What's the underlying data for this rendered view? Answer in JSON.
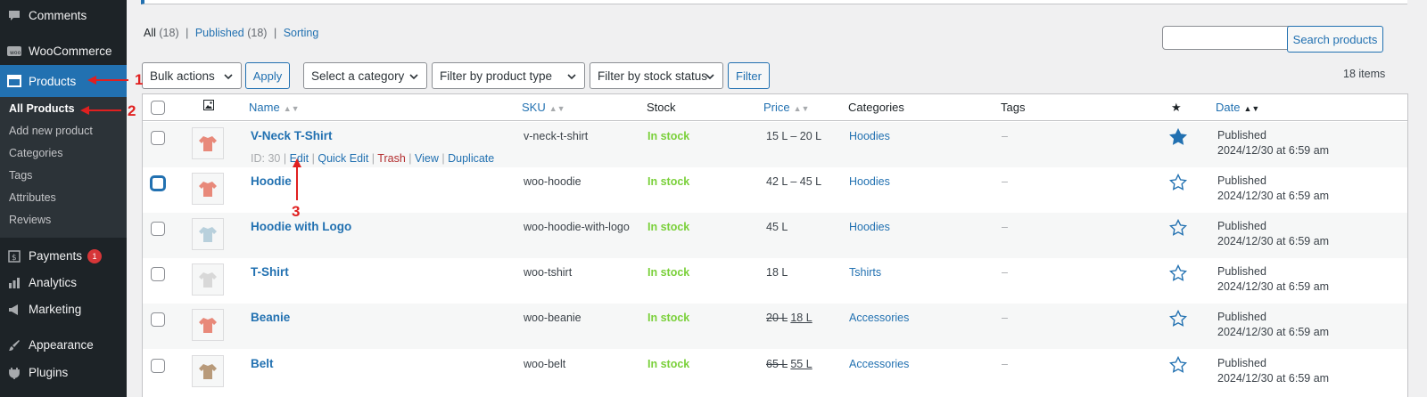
{
  "sidebar": {
    "items": [
      {
        "label": "Comments",
        "icon": "comments-icon"
      },
      {
        "label": "WooCommerce",
        "icon": "woocommerce-icon"
      },
      {
        "label": "Products",
        "icon": "products-icon"
      },
      {
        "label": "Payments",
        "icon": "payments-icon",
        "badge": "1"
      },
      {
        "label": "Analytics",
        "icon": "analytics-icon"
      },
      {
        "label": "Marketing",
        "icon": "marketing-icon"
      },
      {
        "label": "Appearance",
        "icon": "appearance-icon"
      },
      {
        "label": "Plugins",
        "icon": "plugins-icon"
      }
    ],
    "submenu": [
      "All Products",
      "Add new product",
      "Categories",
      "Tags",
      "Attributes",
      "Reviews"
    ]
  },
  "views": {
    "all": "All",
    "all_count": "(18)",
    "sep": "|",
    "published": "Published",
    "published_count": "(18)",
    "sorting": "Sorting"
  },
  "search": {
    "value": "",
    "button": "Search products"
  },
  "toolbar": {
    "bulk_actions": "Bulk actions",
    "apply": "Apply",
    "category": "Select a category",
    "product_type": "Filter by product type",
    "stock_status": "Filter by stock status",
    "filter": "Filter",
    "items_count": "18 items"
  },
  "table": {
    "headers": {
      "name": "Name",
      "sku": "SKU",
      "stock": "Stock",
      "price": "Price",
      "categories": "Categories",
      "tags": "Tags",
      "date": "Date"
    },
    "rows": [
      {
        "name": "V-Neck T-Shirt",
        "sku": "v-neck-t-shirt",
        "stock": "In stock",
        "price": "15 L – 20 L",
        "category": "Hoodies",
        "tags": "–",
        "status": "Published",
        "date": "2024/12/30 at 6:59 am",
        "featured": true
      },
      {
        "name": "Hoodie",
        "sku": "woo-hoodie",
        "stock": "In stock",
        "price": "42 L – 45 L",
        "category": "Hoodies",
        "tags": "–",
        "status": "Published",
        "date": "2024/12/30 at 6:59 am",
        "featured": false
      },
      {
        "name": "Hoodie with Logo",
        "sku": "woo-hoodie-with-logo",
        "stock": "In stock",
        "price": "45 L",
        "category": "Hoodies",
        "tags": "–",
        "status": "Published",
        "date": "2024/12/30 at 6:59 am",
        "featured": false
      },
      {
        "name": "T-Shirt",
        "sku": "woo-tshirt",
        "stock": "In stock",
        "price": "18 L",
        "category": "Tshirts",
        "tags": "–",
        "status": "Published",
        "date": "2024/12/30 at 6:59 am",
        "featured": false
      },
      {
        "name": "Beanie",
        "sku": "woo-beanie",
        "stock": "In stock",
        "price_old": "20 L",
        "price_new": "18 L",
        "category": "Accessories",
        "tags": "–",
        "status": "Published",
        "date": "2024/12/30 at 6:59 am",
        "featured": false
      },
      {
        "name": "Belt",
        "sku": "woo-belt",
        "stock": "In stock",
        "price_old": "65 L",
        "price_new": "55 L",
        "category": "Accessories",
        "tags": "–",
        "status": "Published",
        "date": "2024/12/30 at 6:59 am",
        "featured": false
      }
    ],
    "row_actions": {
      "id": "ID: 30",
      "edit": "Edit",
      "quick_edit": "Quick Edit",
      "trash": "Trash",
      "view": "View",
      "duplicate": "Duplicate",
      "sep": "|"
    }
  },
  "annotations": [
    "1",
    "2",
    "3"
  ],
  "colors": {
    "accent": "#2271b1",
    "in_stock": "#7ad03a",
    "annotation": "#e02020",
    "sidebar": "#1d2327"
  }
}
